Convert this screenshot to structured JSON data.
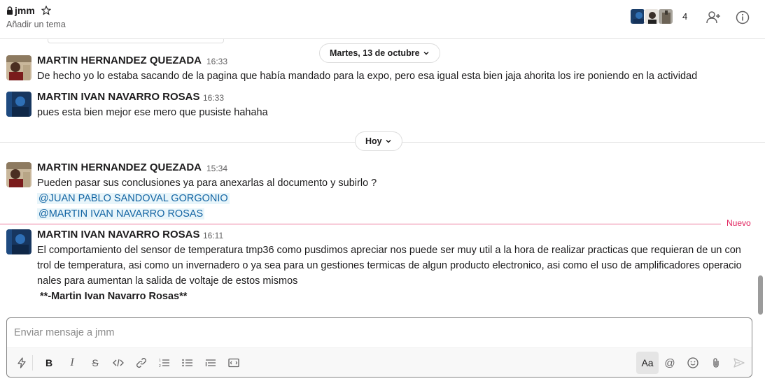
{
  "header": {
    "channel_name": "jmm",
    "topic": "Añadir un tema",
    "member_count": "4"
  },
  "dates": {
    "first": "Martes, 13 de octubre",
    "second": "Hoy"
  },
  "messages": [
    {
      "author": "MARTIN HERNANDEZ QUEZADA",
      "time": "16:33",
      "text": "De hecho yo lo estaba sacando de la pagina que había mandado para la expo, pero esa igual esta bien jaja ahorita los ire poniendo en la actividad"
    },
    {
      "author": "MARTIN IVAN NAVARRO ROSAS",
      "time": "16:33",
      "text": "pues esta bien mejor ese mero que pusiste hahaha"
    },
    {
      "author": "MARTIN HERNANDEZ QUEZADA",
      "time": "15:34",
      "text": "Pueden pasar sus conclusiones ya para anexarlas al documento y subirlo ?",
      "mentions": [
        "@JUAN PABLO SANDOVAL GORGONIO",
        "@MARTIN IVAN NAVARRO ROSAS"
      ]
    },
    {
      "author": "MARTIN IVAN NAVARRO ROSAS",
      "time": "16:11",
      "lines": [
        "El comportamiento del sensor de temperatura tmp36 como pusdimos apreciar nos puede ser muy util a la hora de realizar practicas que requieran de un con",
        "trol de temperatura, asi como un invernadero o ya sea para un gestiones termicas de algun producto electronico, asi como el uso de amplificadores operacio",
        "nales para aumentan la salida de voltaje de estos mismos",
        " **-Martin Ivan Navarro Rosas**"
      ]
    }
  ],
  "new_label": "Nuevo",
  "composer": {
    "placeholder": "Enviar mensaje a jmm",
    "format_label": "Aa"
  },
  "icons": {
    "lock": "lock-icon",
    "star": "star-icon",
    "add_member": "add-member-icon",
    "info": "info-icon",
    "shortcuts": "lightning-icon",
    "bold": "bold-icon",
    "italic": "italic-icon",
    "strike": "strikethrough-icon",
    "code": "code-icon",
    "link": "link-icon",
    "ordered_list": "ordered-list-icon",
    "bullet_list": "bullet-list-icon",
    "quote": "blockquote-icon",
    "code_block": "code-block-icon",
    "mention": "at-icon",
    "emoji": "emoji-icon",
    "attach": "paperclip-icon",
    "send": "send-icon"
  },
  "colors": {
    "mention_bg": "#e8f5fa",
    "mention_text": "#1264a3",
    "new_marker": "#e01e5a"
  }
}
